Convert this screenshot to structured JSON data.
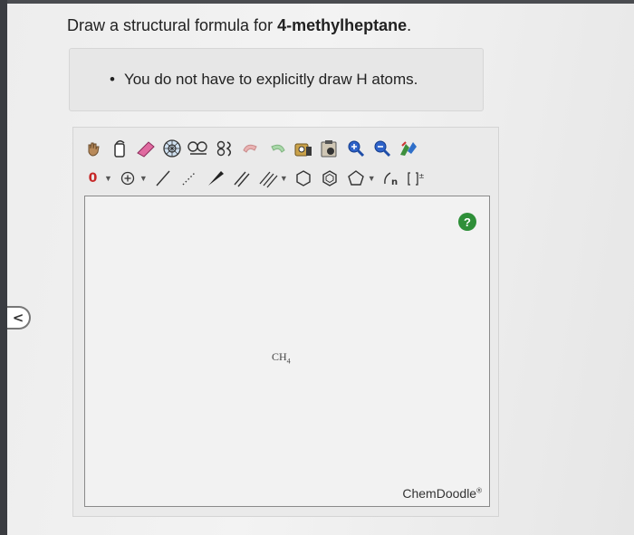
{
  "question": {
    "prefix": "Draw a structural formula for ",
    "compound": "4-methylheptane",
    "suffix": "."
  },
  "hint": {
    "bullet": "•",
    "text": "You do not have to explicitly draw H atoms."
  },
  "editor": {
    "charge_label": "0",
    "help_label": "?",
    "canvas_molecule": {
      "base": "CH",
      "sub": "4"
    },
    "brand": "ChemDoodle",
    "brand_mark": "®"
  },
  "back_label": "<",
  "colors": {
    "help_bg": "#2e8f38",
    "charge_red": "#c62828"
  },
  "icons_row1": [
    "hand-icon",
    "lasso-icon",
    "eraser-icon",
    "template-icon",
    "ring-chain-icon",
    "undo-icon",
    "redo-icon",
    "zoom-in-icon",
    "zoom-out-icon",
    "clean-icon"
  ],
  "icons_row2": [
    "charge-icon",
    "atom-plus-icon",
    "single-bond-icon",
    "dashed-bond-icon",
    "wedge-bond-icon",
    "double-bond-icon",
    "triple-bond-icon",
    "cyclohexane-icon",
    "benzene-icon",
    "pentagon-icon",
    "repeat-unit-icon",
    "bracket-charge-icon"
  ]
}
